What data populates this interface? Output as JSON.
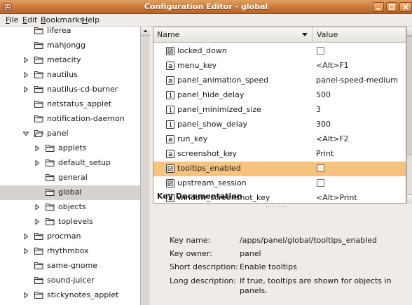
{
  "window": {
    "title": "Configuration Editor - global",
    "colors": {
      "titlebar": "#c9783a",
      "selection": "#f5c37d",
      "tree_selection": "#d6d2cd"
    }
  },
  "menubar": {
    "items": [
      {
        "label": "File",
        "mnemonic": "F",
        "rest": "ile"
      },
      {
        "label": "Edit",
        "mnemonic": "E",
        "rest": "dit"
      },
      {
        "label": "Bookmarks",
        "mnemonic": "B",
        "rest": "ookmarks"
      },
      {
        "label": "Help",
        "mnemonic": "H",
        "rest": "elp"
      }
    ]
  },
  "tree": {
    "items": [
      {
        "label": "liferea",
        "level": 1,
        "expander": "none",
        "open": false,
        "selected": false
      },
      {
        "label": "mahjongg",
        "level": 1,
        "expander": "none",
        "open": false,
        "selected": false
      },
      {
        "label": "metacity",
        "level": 1,
        "expander": "collapsed",
        "open": false,
        "selected": false
      },
      {
        "label": "nautilus",
        "level": 1,
        "expander": "collapsed",
        "open": false,
        "selected": false
      },
      {
        "label": "nautilus-cd-burner",
        "level": 1,
        "expander": "collapsed",
        "open": false,
        "selected": false
      },
      {
        "label": "netstatus_applet",
        "level": 1,
        "expander": "none",
        "open": false,
        "selected": false
      },
      {
        "label": "notification-daemon",
        "level": 1,
        "expander": "none",
        "open": false,
        "selected": false
      },
      {
        "label": "panel",
        "level": 1,
        "expander": "expanded",
        "open": true,
        "selected": false
      },
      {
        "label": "applets",
        "level": 2,
        "expander": "collapsed",
        "open": false,
        "selected": false
      },
      {
        "label": "default_setup",
        "level": 2,
        "expander": "collapsed",
        "open": false,
        "selected": false
      },
      {
        "label": "general",
        "level": 2,
        "expander": "none",
        "open": false,
        "selected": false
      },
      {
        "label": "global",
        "level": 2,
        "expander": "none",
        "open": false,
        "selected": true
      },
      {
        "label": "objects",
        "level": 2,
        "expander": "collapsed",
        "open": false,
        "selected": false
      },
      {
        "label": "toplevels",
        "level": 2,
        "expander": "collapsed",
        "open": false,
        "selected": false
      },
      {
        "label": "procman",
        "level": 1,
        "expander": "collapsed",
        "open": false,
        "selected": false
      },
      {
        "label": "rhythmbox",
        "level": 1,
        "expander": "collapsed",
        "open": false,
        "selected": false
      },
      {
        "label": "same-gnome",
        "level": 1,
        "expander": "none",
        "open": false,
        "selected": false
      },
      {
        "label": "sound-juicer",
        "level": 1,
        "expander": "none",
        "open": false,
        "selected": false
      },
      {
        "label": "stickynotes_applet",
        "level": 1,
        "expander": "collapsed",
        "open": false,
        "selected": false
      }
    ]
  },
  "list": {
    "columns": {
      "name": "Name",
      "value": "Value"
    },
    "rows": [
      {
        "name": "locked_down",
        "type": "bool",
        "value": "",
        "checked": false,
        "selected": false
      },
      {
        "name": "menu_key",
        "type": "string",
        "value": "<Alt>F1",
        "selected": false
      },
      {
        "name": "panel_animation_speed",
        "type": "string",
        "value": "panel-speed-medium",
        "selected": false
      },
      {
        "name": "panel_hide_delay",
        "type": "int",
        "value": "500",
        "selected": false
      },
      {
        "name": "panel_minimized_size",
        "type": "int",
        "value": "3",
        "selected": false
      },
      {
        "name": "panel_show_delay",
        "type": "int",
        "value": "300",
        "selected": false
      },
      {
        "name": "run_key",
        "type": "string",
        "value": "<Alt>F2",
        "selected": false
      },
      {
        "name": "screenshot_key",
        "type": "string",
        "value": "Print",
        "selected": false
      },
      {
        "name": "tooltips_enabled",
        "type": "bool",
        "value": "",
        "checked": false,
        "selected": true
      },
      {
        "name": "upstream_session",
        "type": "bool",
        "value": "",
        "checked": false,
        "selected": false
      },
      {
        "name": "window_screenshot_key",
        "type": "string",
        "value": "<Alt>Print",
        "selected": false
      }
    ]
  },
  "doc": {
    "title": "Key Documentation",
    "key_name_label": "Key name:",
    "key_name": "/apps/panel/global/tooltips_enabled",
    "key_owner_label": "Key owner:",
    "key_owner": "panel",
    "short_desc_label": "Short description:",
    "short_desc": "Enable tooltips",
    "long_desc_label": "Long description:",
    "long_desc_line1": "If true, tooltips are shown for objects in",
    "long_desc_line2": "panels."
  }
}
